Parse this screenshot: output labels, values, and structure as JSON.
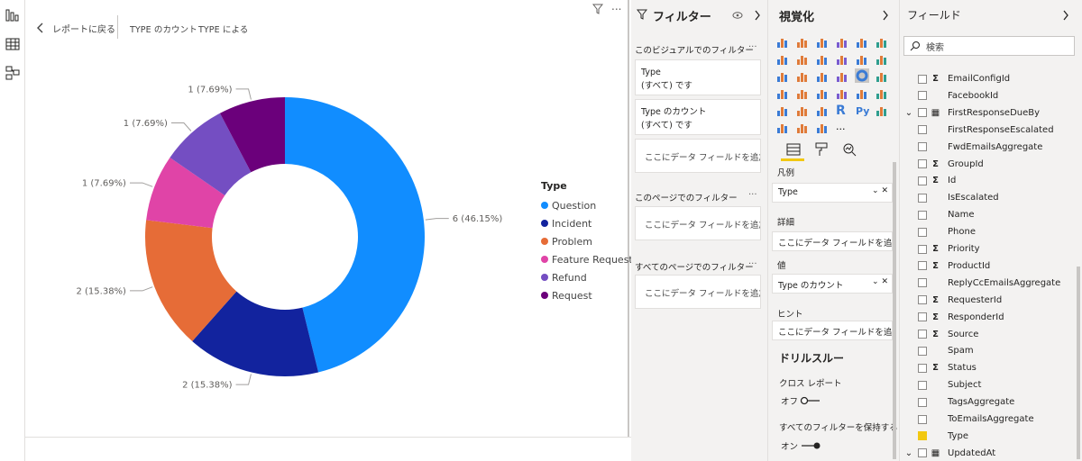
{
  "nav": {
    "back_label": "レポートに戻る",
    "breadcrumb": [
      "TYPE のカウント",
      "TYPE による"
    ]
  },
  "chart_data": {
    "type": "pie",
    "variant": "donut",
    "legend_title": "Type",
    "legend_position": "right",
    "slices": [
      {
        "label": "Question",
        "value": 6,
        "pct_label": "6 (46.15%)",
        "color": "#118dff"
      },
      {
        "label": "Incident",
        "value": 2,
        "pct_label": "2 (15.38%)",
        "color": "#12239e"
      },
      {
        "label": "Problem",
        "value": 2,
        "pct_label": "2 (15.38%)",
        "color": "#e66c37"
      },
      {
        "label": "Feature Request",
        "value": 1,
        "pct_label": "1 (7.69%)",
        "color": "#e044a7"
      },
      {
        "label": "Refund",
        "value": 1,
        "pct_label": "1 (7.69%)",
        "color": "#744ec2"
      },
      {
        "label": "Request",
        "value": 1,
        "pct_label": "1 (7.69%)",
        "color": "#6b007b"
      }
    ]
  },
  "filters": {
    "title": "フィルター",
    "visual_section": "このビジュアルでのフィルター",
    "cards": [
      {
        "name": "Type",
        "value": "(すべて) です"
      },
      {
        "name": "Type のカウント",
        "value": "(すべて) です"
      }
    ],
    "add_field": "ここにデータ フィールドを追加し...",
    "page_section": "このページでのフィルター",
    "all_pages_section": "すべてのページでのフィルター"
  },
  "viz": {
    "title": "視覚化",
    "legend_label": "凡例",
    "legend_value": "Type",
    "details_label": "詳細",
    "details_placeholder": "ここにデータ フィールドを追加して...",
    "values_label": "値",
    "values_value": "Type のカウント",
    "tooltips_label": "ヒント",
    "tooltips_placeholder": "ここにデータ フィールドを追加して...",
    "drill_title": "ドリルスルー",
    "cross_report": "クロス レポート",
    "off": "オフ",
    "keep_filters": "すべてのフィルターを保持する",
    "on": "オン",
    "more": "..."
  },
  "fields": {
    "title": "フィールド",
    "search_placeholder": "検索",
    "items": [
      {
        "name": "EmailConfigId",
        "sigma": true,
        "checked": false
      },
      {
        "name": "FacebookId",
        "sigma": false,
        "checked": false
      },
      {
        "name": "FirstResponseDueBy",
        "sigma": false,
        "checked": false,
        "expand": true,
        "table": true
      },
      {
        "name": "FirstResponseEscalated",
        "sigma": false,
        "checked": false
      },
      {
        "name": "FwdEmailsAggregate",
        "sigma": false,
        "checked": false
      },
      {
        "name": "GroupId",
        "sigma": true,
        "checked": false
      },
      {
        "name": "Id",
        "sigma": true,
        "checked": false
      },
      {
        "name": "IsEscalated",
        "sigma": false,
        "checked": false
      },
      {
        "name": "Name",
        "sigma": false,
        "checked": false
      },
      {
        "name": "Phone",
        "sigma": false,
        "checked": false
      },
      {
        "name": "Priority",
        "sigma": true,
        "checked": false
      },
      {
        "name": "ProductId",
        "sigma": true,
        "checked": false
      },
      {
        "name": "ReplyCcEmailsAggregate",
        "sigma": false,
        "checked": false
      },
      {
        "name": "RequesterId",
        "sigma": true,
        "checked": false
      },
      {
        "name": "ResponderId",
        "sigma": true,
        "checked": false
      },
      {
        "name": "Source",
        "sigma": true,
        "checked": false
      },
      {
        "name": "Spam",
        "sigma": false,
        "checked": false
      },
      {
        "name": "Status",
        "sigma": true,
        "checked": false
      },
      {
        "name": "Subject",
        "sigma": false,
        "checked": false
      },
      {
        "name": "TagsAggregate",
        "sigma": false,
        "checked": false
      },
      {
        "name": "ToEmailsAggregate",
        "sigma": false,
        "checked": false
      },
      {
        "name": "Type",
        "sigma": false,
        "checked": true
      },
      {
        "name": "UpdatedAt",
        "sigma": false,
        "checked": false,
        "expand": true,
        "table": true
      }
    ]
  }
}
